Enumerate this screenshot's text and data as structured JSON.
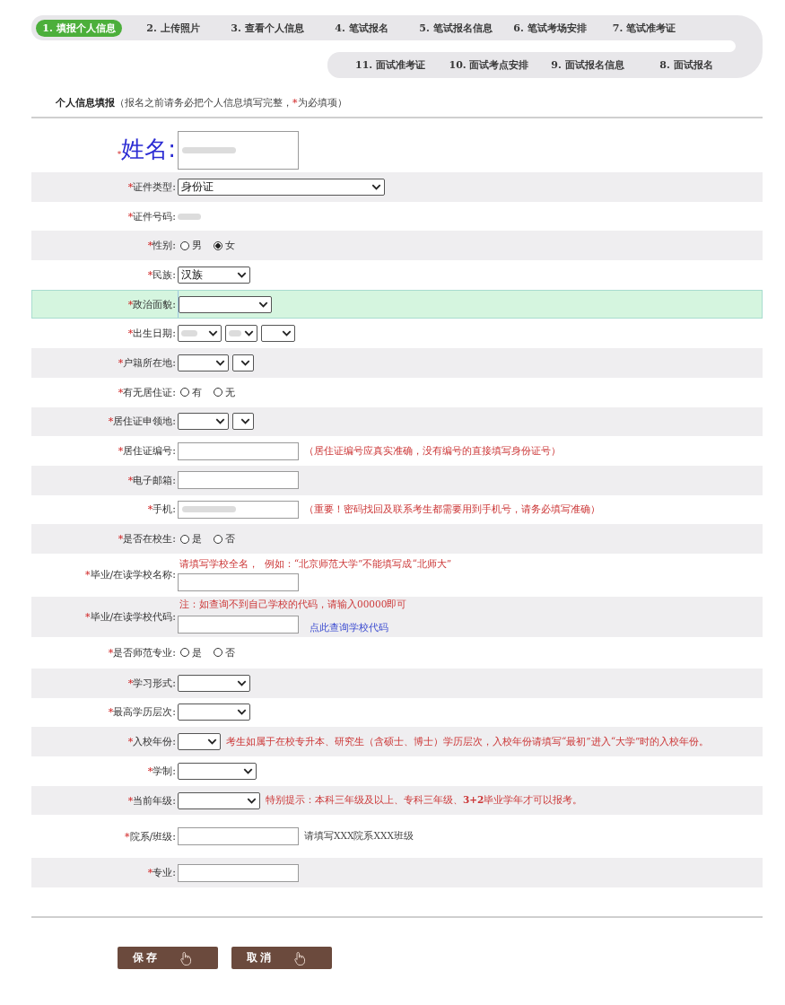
{
  "steps": {
    "rows": [
      {
        "items": [
          {
            "label": "1. 填报个人信息",
            "selected": true
          },
          {
            "label": "2. 上传照片",
            "selected": false
          },
          {
            "label": "3. 查看个人信息",
            "selected": false
          },
          {
            "label": "4. 笔试报名",
            "selected": false
          },
          {
            "label": "5. 笔试报名信息",
            "selected": false
          },
          {
            "label": "6. 笔试考场安排",
            "selected": false
          },
          {
            "label": "7. 笔试准考证",
            "selected": false
          }
        ]
      },
      {
        "items": [
          {
            "label": "11. 面试准考证",
            "selected": false
          },
          {
            "label": "10. 面试考点安排",
            "selected": false
          },
          {
            "label": "9. 面试报名信息",
            "selected": false
          },
          {
            "label": "8. 面试报名",
            "selected": false
          }
        ]
      }
    ]
  },
  "section": {
    "title": "个人信息填报",
    "note_before": "（报名之前请务必把个人信息填写完整，",
    "note_mark": "*",
    "note_after": "为必填项）"
  },
  "form": {
    "rows": [
      {
        "kind": "name",
        "mark": "*",
        "label": "姓名:",
        "highlighted": false,
        "lines": [
          [
            {
              "kind": "input",
              "redacted": true
            }
          ]
        ]
      },
      {
        "kind": "field",
        "mark": "*",
        "label": "证件类型:",
        "highlighted": false,
        "lines": [
          [
            {
              "kind": "select",
              "value": "身份证",
              "redacted": false
            }
          ]
        ]
      },
      {
        "kind": "field",
        "mark": "*",
        "label": "证件号码:",
        "highlighted": false,
        "lines": [
          [
            {
              "kind": "blurred"
            }
          ]
        ]
      },
      {
        "kind": "field",
        "mark": "*",
        "label": "性别:",
        "highlighted": false,
        "lines": [
          [
            {
              "kind": "radio",
              "label": "男",
              "selected": false
            },
            {
              "kind": "radio",
              "label": "女",
              "selected": true
            }
          ]
        ]
      },
      {
        "kind": "field",
        "mark": "*",
        "label": "民族:",
        "highlighted": false,
        "lines": [
          [
            {
              "kind": "select",
              "value": "汉族",
              "redacted": false
            }
          ]
        ]
      },
      {
        "kind": "field",
        "mark": "*",
        "label": "政治面貌:",
        "highlighted": true,
        "lines": [
          [
            {
              "kind": "select",
              "redacted": false
            }
          ]
        ]
      },
      {
        "kind": "field",
        "mark": "*",
        "label": "出生日期:",
        "highlighted": false,
        "lines": [
          [
            {
              "kind": "select",
              "redacted": true
            },
            {
              "kind": "select",
              "redacted": true
            },
            {
              "kind": "select",
              "redacted": false
            }
          ]
        ]
      },
      {
        "kind": "field",
        "mark": "*",
        "label": "户籍所在地:",
        "highlighted": false,
        "lines": [
          [
            {
              "kind": "select",
              "redacted": false
            },
            {
              "kind": "select",
              "redacted": false
            }
          ]
        ]
      },
      {
        "kind": "field",
        "mark": "*",
        "label": "有无居住证:",
        "highlighted": false,
        "lines": [
          [
            {
              "kind": "radio",
              "label": "有",
              "selected": false
            },
            {
              "kind": "radio",
              "label": "无",
              "selected": false
            }
          ]
        ]
      },
      {
        "kind": "field",
        "mark": "*",
        "label": "居住证申领地:",
        "highlighted": false,
        "lines": [
          [
            {
              "kind": "select",
              "redacted": false
            },
            {
              "kind": "select",
              "redacted": false
            }
          ]
        ]
      },
      {
        "kind": "field",
        "mark": "*",
        "label": "居住证编号:",
        "highlighted": false,
        "lines": [
          [
            {
              "kind": "input",
              "redacted": false
            },
            {
              "kind": "warning",
              "text": "（居住证编号应真实准确，没有编号的直接填写身份证号）"
            }
          ]
        ]
      },
      {
        "kind": "field",
        "mark": "*",
        "label": "电子邮箱:",
        "highlighted": false,
        "lines": [
          [
            {
              "kind": "input",
              "redacted": false
            }
          ]
        ]
      },
      {
        "kind": "field",
        "mark": "*",
        "label": "手机:",
        "highlighted": false,
        "lines": [
          [
            {
              "kind": "input",
              "redacted": true
            },
            {
              "kind": "warning",
              "text": "（重要！密码找回及联系考生都需要用到手机号，请务必填写准确）"
            }
          ]
        ]
      },
      {
        "kind": "field",
        "mark": "*",
        "label": "是否在校生:",
        "highlighted": false,
        "lines": [
          [
            {
              "kind": "radio",
              "label": "是",
              "selected": false
            },
            {
              "kind": "radio",
              "label": "否",
              "selected": false
            }
          ]
        ]
      },
      {
        "kind": "field",
        "mark": "*",
        "label": "毕业/在读学校名称:",
        "highlighted": false,
        "lines": [
          [
            {
              "kind": "warning",
              "text": "请填写学校全名，  例如：“北京师范大学”不能填写成“北师大”"
            }
          ],
          [
            {
              "kind": "input",
              "redacted": false
            }
          ]
        ]
      },
      {
        "kind": "field",
        "mark": "*",
        "label": "毕业/在读学校代码:",
        "highlighted": false,
        "lines": [
          [
            {
              "kind": "warning",
              "text": "注：如查询不到自己学校的代码，请输入00000即可"
            }
          ],
          [
            {
              "kind": "input",
              "redacted": false
            },
            {
              "kind": "link",
              "text": "点此查询学校代码"
            }
          ]
        ]
      },
      {
        "kind": "field",
        "mark": "*",
        "label": "是否师范专业:",
        "highlighted": false,
        "lines": [
          [
            {
              "kind": "radio",
              "label": "是",
              "selected": false
            },
            {
              "kind": "radio",
              "label": "否",
              "selected": false
            }
          ]
        ]
      },
      {
        "kind": "field",
        "mark": "*",
        "label": "学习形式:",
        "highlighted": false,
        "lines": [
          [
            {
              "kind": "select",
              "redacted": false
            }
          ]
        ]
      },
      {
        "kind": "field",
        "mark": "*",
        "label": "最高学历层次:",
        "highlighted": false,
        "lines": [
          [
            {
              "kind": "select",
              "redacted": false
            }
          ]
        ]
      },
      {
        "kind": "field",
        "mark": "*",
        "label": "入校年份:",
        "highlighted": false,
        "lines": [
          [
            {
              "kind": "select",
              "redacted": false
            },
            {
              "kind": "warning",
              "text": "考生如属于在校专升本、研究生（含硕士、博士）学历层次，入校年份请填写“最初”进入“大学”时的入校年份。"
            }
          ]
        ]
      },
      {
        "kind": "field",
        "mark": "*",
        "label": "学制:",
        "highlighted": false,
        "lines": [
          [
            {
              "kind": "select",
              "redacted": false
            }
          ]
        ]
      },
      {
        "kind": "field",
        "mark": "*",
        "label": "当前年级:",
        "highlighted": false,
        "lines": [
          [
            {
              "kind": "select",
              "redacted": false
            },
            {
              "kind": "warning",
              "text": "特别提示：本科三年级及以上、专科三年级、**3+2**毕业学年才可以报考。"
            }
          ]
        ]
      },
      {
        "kind": "field",
        "mark": "*",
        "label": "院系/班级:",
        "highlighted": false,
        "lines": [
          [
            {
              "kind": "input",
              "redacted": false
            },
            {
              "kind": "hint",
              "text": "请填写XXX院系XXX班级"
            }
          ]
        ]
      },
      {
        "kind": "field",
        "mark": "*",
        "label": "专业:",
        "highlighted": false,
        "lines": [
          [
            {
              "kind": "input",
              "redacted": false
            }
          ]
        ]
      }
    ]
  },
  "buttons": [
    {
      "label": "保存"
    },
    {
      "label": "取消"
    }
  ]
}
